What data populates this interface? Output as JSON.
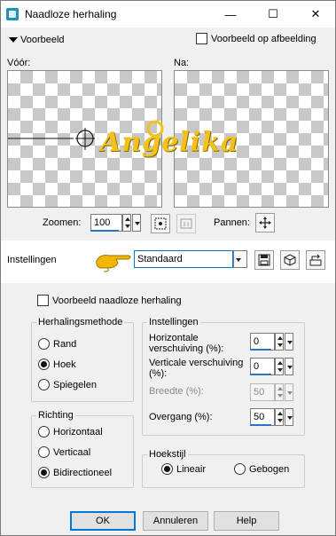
{
  "window": {
    "title": "Naadloze herhaling",
    "minimize_glyph": "—",
    "maximize_glyph": "☐",
    "close_glyph": "✕"
  },
  "preview": {
    "section_label": "Voorbeeld",
    "preview_on_image_label": "Voorbeeld op afbeelding",
    "before_label": "Vóór:",
    "after_label": "Na:"
  },
  "zoom": {
    "label": "Zoomen:",
    "value": "100",
    "pan_label": "Pannen:"
  },
  "settings_bar": {
    "label": "Instellingen",
    "preset_value": "Standaard"
  },
  "watermark": {
    "text": "Angelika",
    "color": "#f2c21a"
  },
  "seamless_preview_label": "Voorbeeld naadloze herhaling",
  "repeat_method": {
    "title": "Herhalingsmethode",
    "options": [
      "Rand",
      "Hoek",
      "Spiegelen"
    ],
    "selected": "Hoek"
  },
  "direction": {
    "title": "Richting",
    "options": [
      "Horizontaal",
      "Verticaal",
      "Bidirectioneel"
    ],
    "selected": "Bidirectioneel"
  },
  "settings_group": {
    "title": "Instellingen",
    "horizontal_offset_label": "Horizontale verschuiving (%):",
    "horizontal_offset_value": "0",
    "vertical_offset_label": "Verticale verschuiving (%):",
    "vertical_offset_value": "0",
    "width_label": "Breedte (%):",
    "width_value": "50",
    "transition_label": "Overgang (%):",
    "transition_value": "50"
  },
  "corner_style": {
    "title": "Hoekstijl",
    "options": [
      "Lineair",
      "Gebogen"
    ],
    "selected": "Lineair"
  },
  "buttons": {
    "ok": "OK",
    "cancel": "Annuleren",
    "help": "Help"
  },
  "colors": {
    "accent": "#2a74c9",
    "focus": "#0078d7",
    "pointer": "#f2b705"
  }
}
